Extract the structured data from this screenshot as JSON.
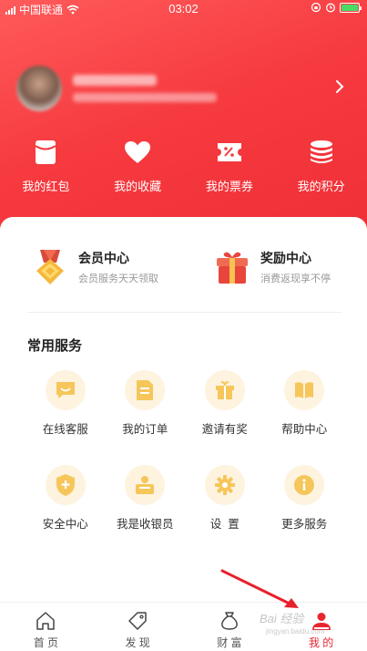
{
  "status_bar": {
    "carrier": "中国联通",
    "time": "03:02"
  },
  "profile": {
    "name_blurred": "132 **** 7849",
    "subtitle_blurred": "完善账户信息，保证账户安全"
  },
  "quick_actions": [
    {
      "label": "我的红包",
      "icon": "red-envelope-icon"
    },
    {
      "label": "我的收藏",
      "icon": "heart-icon"
    },
    {
      "label": "我的票券",
      "icon": "ticket-icon"
    },
    {
      "label": "我的积分",
      "icon": "coins-stack-icon"
    }
  ],
  "promos": {
    "member": {
      "title": "会员中心",
      "subtitle": "会员服务天天领取",
      "icon": "member-medal-icon"
    },
    "reward": {
      "title": "奖励中心",
      "subtitle": "消费返现享不停",
      "icon": "gift-box-icon"
    }
  },
  "services": {
    "title": "常用服务",
    "items": [
      {
        "label": "在线客服",
        "icon": "chat-smile-icon"
      },
      {
        "label": "我的订单",
        "icon": "order-document-icon"
      },
      {
        "label": "邀请有奖",
        "icon": "gift-icon"
      },
      {
        "label": "帮助中心",
        "icon": "book-icon"
      },
      {
        "label": "安全中心",
        "icon": "shield-plus-icon"
      },
      {
        "label": "我是收银员",
        "icon": "cashier-icon"
      },
      {
        "label": "设  置",
        "icon": "gear-icon"
      },
      {
        "label": "更多服务",
        "icon": "info-icon"
      }
    ]
  },
  "tabbar": {
    "tabs": [
      {
        "label": "首 页",
        "icon": "home-icon"
      },
      {
        "label": "发 现",
        "icon": "tag-icon"
      },
      {
        "label": "财 富",
        "icon": "money-bag-icon"
      },
      {
        "label": "我 的",
        "icon": "user-icon",
        "active": true
      }
    ]
  },
  "watermark": {
    "text": "Bai 经验",
    "sub": "jingyan.baidu.com"
  },
  "colors": {
    "brand_red": "#f23b40",
    "service_icon": "#f6c65b",
    "service_bg": "#fdf3df",
    "active_tab": "#e8262f"
  }
}
